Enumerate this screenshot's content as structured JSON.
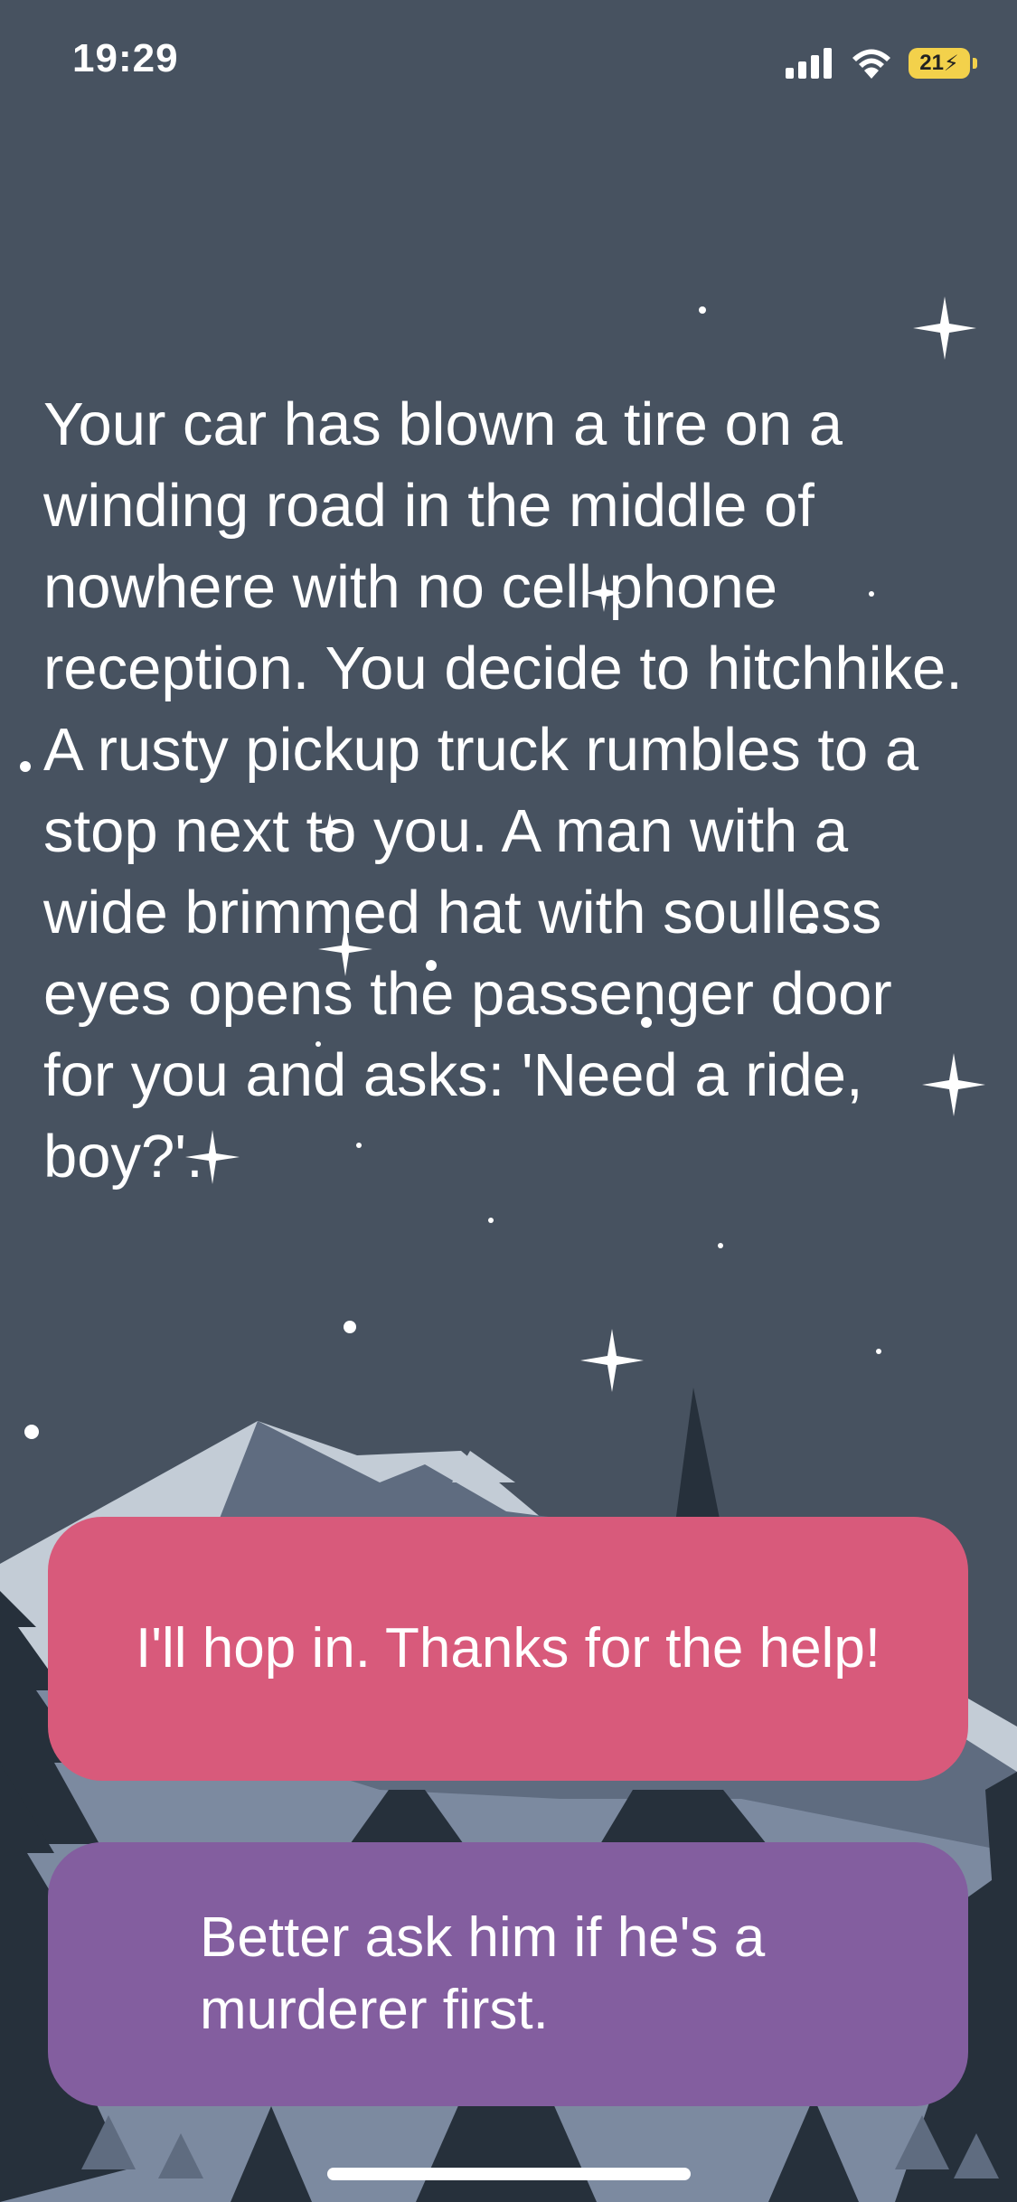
{
  "status_bar": {
    "time": "19:29",
    "battery": "21",
    "icons": [
      "cellular-signal-icon",
      "wifi-icon",
      "battery-charging-icon"
    ]
  },
  "story": {
    "text": "Your car has blown a tire on a winding road in the middle of nowhere with no cell phone reception. You decide to hitchhike. A rusty pickup truck rumbles to a stop next to you. A man with a wide brimmed hat with soulless eyes opens the passenger door for you and asks: 'Need a ride, boy?'."
  },
  "choices": [
    {
      "label": "I'll hop in. Thanks for the help!",
      "color": "#d85a7b"
    },
    {
      "label": "Better ask him if he's a murderer first.",
      "color": "#835e9f"
    }
  ],
  "colors": {
    "background": "#475260",
    "mountain_light": "#c3ccd6",
    "mountain_mid": "#5f6c80",
    "tree_dark": "#26303b",
    "battery": "#f3d14b"
  }
}
